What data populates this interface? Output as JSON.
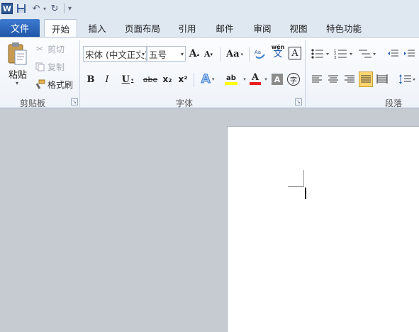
{
  "app": {
    "logo_letter": "W"
  },
  "qat": {
    "undo_dd": "▾",
    "customize": "▾"
  },
  "tabs": {
    "file": "文件",
    "items": [
      "开始",
      "插入",
      "页面布局",
      "引用",
      "邮件",
      "审阅",
      "视图",
      "特色功能"
    ],
    "active": "开始"
  },
  "clipboard": {
    "paste": "粘贴",
    "cut": "剪切",
    "copy": "复制",
    "format_painter": "格式刷",
    "group_label": "剪贴板"
  },
  "font": {
    "font_name": "宋体 (中文正文)",
    "font_size": "五号",
    "grow": "A",
    "shrink": "A",
    "change_case": "Aa",
    "phonetic": "wén",
    "phonetic_char": "文",
    "char_border": "A",
    "bold": "B",
    "italic": "I",
    "underline": "U",
    "strike": "abe",
    "subscript": "x₂",
    "superscript": "x²",
    "text_effect": "A",
    "highlight": "ab",
    "font_color": "A",
    "shading": "A",
    "enclose": "字",
    "group_label": "字体"
  },
  "paragraph": {
    "group_label": "段落"
  },
  "colors": {
    "file_tab": "#2b62b8",
    "highlight": "#ffff00",
    "font_color": "#e81e1e",
    "selected_btn": "#ffd56f"
  }
}
